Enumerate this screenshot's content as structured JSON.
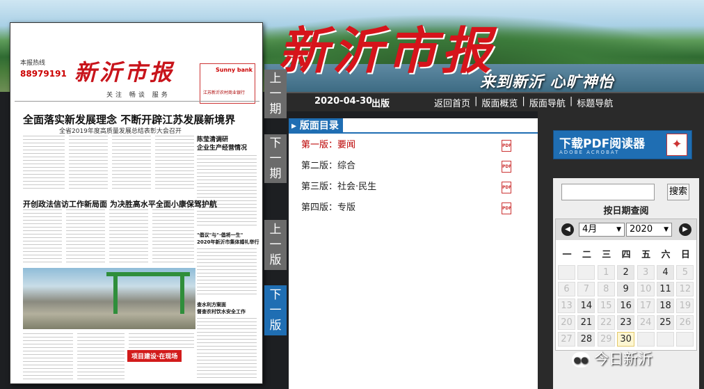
{
  "banner": {
    "logo": "新沂市报",
    "slogan": "来到新沂  心旷神怡"
  },
  "navbar": {
    "date": "2020-04-30",
    "pub_label": "出版",
    "links": [
      "返回首页",
      "版面概览",
      "版面导航",
      "标题导航"
    ]
  },
  "paper": {
    "hotline_label": "本报热线",
    "phone": "88979191",
    "masthead": "新沂市报",
    "motto": "关注  畅谈  服务",
    "bank_name": "Sunny bank",
    "bank_sub": "江苏新沂农村商业银行",
    "headline": "全面落实新发展理念 不断开辟江苏发展新境界",
    "headline_sub": "全省2019年度高质量发展总结表彰大会召开",
    "headline2_pre": "陈玉清调研企业生产经营情况",
    "headline2": "开创政法信访工作新局面 为决胜高水平全面小康保驾护航",
    "side_title": "陈莹清调研\n企业生产经营情况",
    "side2": "\"倡议\"与\"·倡将一生\"\n2020年新沂市集体婚礼举行",
    "side3": "查水利方案面\n督查农村饮水安全工作",
    "photo_tag": "项目建设·在现场"
  },
  "pagebtns": {
    "prev_period": "上一期",
    "next_period": "下一期",
    "prev_page": "上一版",
    "next_page": "下一版"
  },
  "directory": {
    "title": "版面目录",
    "items": [
      {
        "label": "第一版：要闻",
        "active": true
      },
      {
        "label": "第二版：综合"
      },
      {
        "label": "第三版：社会·民生"
      },
      {
        "label": "第四版：专版"
      }
    ],
    "pdf_icon": "pdf-icon"
  },
  "pdfreader": {
    "title": "下载PDF阅读器",
    "sub": "ADOBE ACROBAT"
  },
  "search": {
    "button": "搜索",
    "label": "按日期查阅",
    "value": ""
  },
  "calendar": {
    "month": "4月",
    "year": "2020",
    "weekdays": [
      "一",
      "二",
      "三",
      "四",
      "五",
      "六",
      "日"
    ],
    "days": [
      [
        "",
        "",
        "1",
        "2",
        "3",
        "4",
        "5"
      ],
      [
        "6",
        "7",
        "8",
        "9",
        "10",
        "11",
        "12"
      ],
      [
        "13",
        "14",
        "15",
        "16",
        "17",
        "18",
        "19"
      ],
      [
        "20",
        "21",
        "22",
        "23",
        "24",
        "25",
        "26"
      ],
      [
        "27",
        "28",
        "29",
        "30",
        "",
        "",
        ""
      ]
    ],
    "active_days": [
      "2",
      "4",
      "9",
      "11",
      "14",
      "16",
      "18",
      "21",
      "23",
      "25",
      "28",
      "30"
    ],
    "today": "30"
  },
  "watermark": "今日新沂",
  "colors": {
    "accent": "#1f6eb3",
    "brand_red": "#d6141b",
    "active_item": "#bb0000"
  }
}
